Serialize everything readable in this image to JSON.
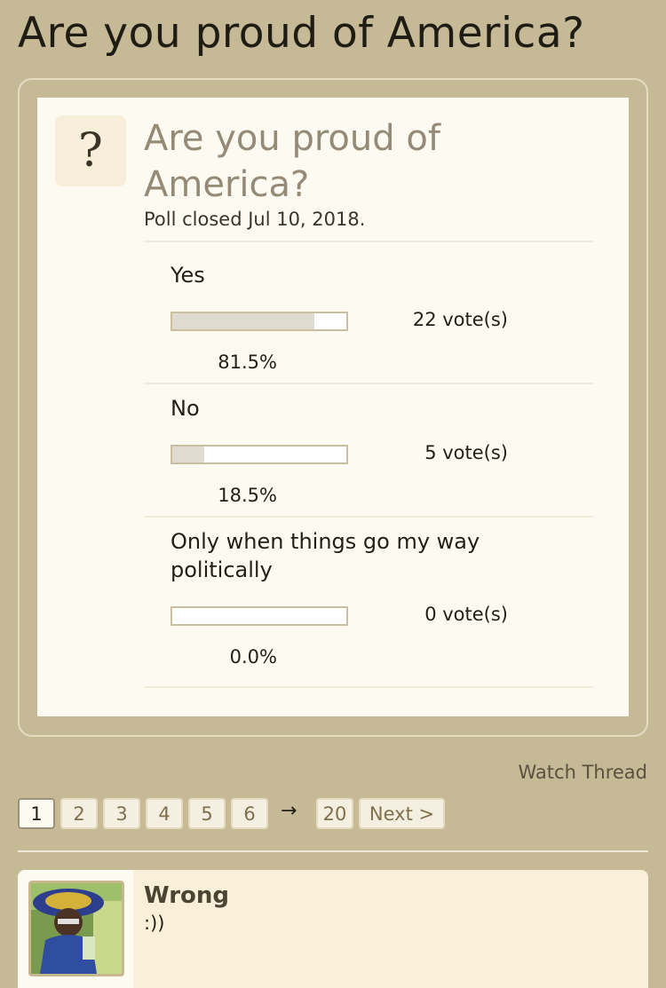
{
  "page": {
    "title": "Are you proud of America?"
  },
  "poll": {
    "question": "Are you proud of America?",
    "icon": "question-mark-icon",
    "status": "Poll closed Jul 10, 2018.",
    "options": [
      {
        "label": "Yes",
        "votes": "22 vote(s)",
        "percent": "81.5%",
        "fraction": 0.815
      },
      {
        "label": "No",
        "votes": "5 vote(s)",
        "percent": "18.5%",
        "fraction": 0.185
      },
      {
        "label": "Only when things go my way politically",
        "votes": "0 vote(s)",
        "percent": "0.0%",
        "fraction": 0.0
      }
    ]
  },
  "thread": {
    "watch_label": "Watch Thread"
  },
  "pagination": {
    "pages": [
      "1",
      "2",
      "3",
      "4",
      "5",
      "6"
    ],
    "current": "1",
    "arrow": "→",
    "last": "20",
    "next_label": "Next >"
  },
  "post": {
    "author": "Wrong",
    "text": ":))"
  },
  "colors": {
    "background": "#c6b996",
    "panel": "#fdfaf2",
    "accent_text": "#948a76",
    "bar_fill": "#e0dbcf"
  }
}
